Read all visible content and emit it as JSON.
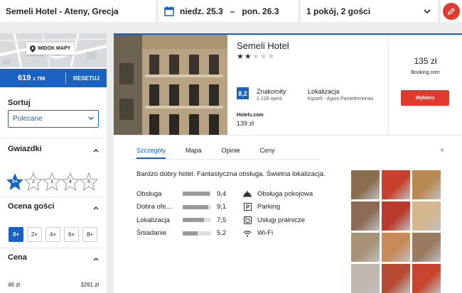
{
  "search": {
    "destination": "Semeli Hotel - Ateny, Grecja",
    "checkin": "niedz. 25.3",
    "date_separator": "–",
    "checkout": "pon. 26.3",
    "guests": "1 pokój, 2 gości"
  },
  "sidebar": {
    "map_label": "WIDOK MAPY",
    "price_value": "619",
    "price_of": "z 789",
    "reset_label": "RESETUJ",
    "sort_title": "Sortuj",
    "sort_value": "Polecane",
    "stars_title": "Gwiazdki",
    "stars_options": [
      "0+",
      "2",
      "3",
      "4",
      "5"
    ],
    "guest_rating_title": "Ocena gości",
    "guest_rating_options": [
      "0+",
      "2+",
      "4+",
      "6+",
      "8+"
    ],
    "price_title": "Cena",
    "price_min": "46 zł",
    "price_max": "3261 zł"
  },
  "hotel": {
    "name": "Semeli Hotel",
    "stars_display": "★★★★★",
    "stars_filled": 2,
    "score": "8,2",
    "score_label": "Znakomity",
    "reviews": "1 128 opinii",
    "location_title": "Lokalizacja",
    "location": "Kipseli - Agios Panteleimonas",
    "source": "Hotels.com",
    "source_price": "139 zł",
    "best_price": "135 zł",
    "best_source": "Booking.com",
    "select_label": "Wybierz"
  },
  "details": {
    "tabs": [
      "Szczegóły",
      "Mapa",
      "Opinie",
      "Ceny"
    ],
    "close": "×",
    "description": "Bardzo dobry hotel. Fantastyczna obsługa. Świetna lokalizacja.",
    "ratings": [
      {
        "name": "Obsługa",
        "value": "9,4",
        "fraction": 0.94
      },
      {
        "name": "Dobra ofe...",
        "value": "9,1",
        "fraction": 0.91
      },
      {
        "name": "Lokalizacja",
        "value": "7,5",
        "fraction": 0.75
      },
      {
        "name": "Śniadanie",
        "value": "5,2",
        "fraction": 0.52
      }
    ],
    "amenities": [
      {
        "label": "Obsługa pokojowa",
        "icon": "room-service-icon"
      },
      {
        "label": "Parking",
        "icon": "parking-icon"
      },
      {
        "label": "Usługi pralnicze",
        "icon": "laundry-icon"
      },
      {
        "label": "Wi-Fi",
        "icon": "wifi-icon"
      }
    ],
    "gallery_colors": [
      "#8a6d4e",
      "#c9402c",
      "#b88a52",
      "#8c6a55",
      "#b93a2c",
      "#d4b690",
      "#a89278",
      "#c98a5a",
      "#9a7a60",
      "#c0b6ae",
      "#b74a34",
      "#c6452c"
    ]
  },
  "colors": {
    "accent": "#1a62c2",
    "cta": "#e03a2e"
  }
}
